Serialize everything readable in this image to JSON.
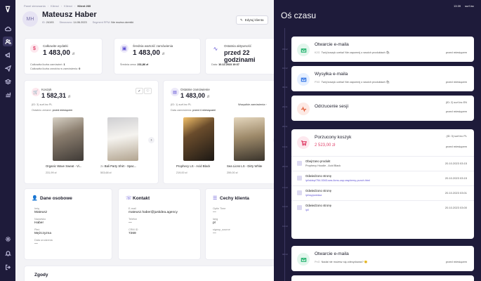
{
  "breadcrumbs": [
    "Panel sterowania",
    "Klienci",
    "Klienci",
    "Klient 260"
  ],
  "customer": {
    "initials": "MH",
    "name": "Mateusz Haber",
    "id_label": "ID:",
    "id": "24193",
    "created_label": "Stworzono:",
    "created": "14.06.2023",
    "segment_label": "Segment RFM:",
    "segment": "Nie można określić"
  },
  "edit_button": "Edytuj klienta",
  "stats": {
    "total_spend": {
      "label": "Całkowite wydatki",
      "value": "1 483,00",
      "currency": "zł",
      "orders_label": "Całkowita liczba zamówień:",
      "orders": "1",
      "returns_label": "Całkowita liczba zwrotów w zamówieniu:",
      "returns": "0"
    },
    "avg_order": {
      "label": "Średnia wartość zamówienia",
      "value": "1 483,00",
      "currency": "zł",
      "avg_price_label": "Średnia cena:",
      "avg_price": "231,86 zł"
    },
    "last_activity": {
      "label": "Ostatnia aktywność",
      "value": "przed 22 godzinami",
      "date_label": "Data:",
      "date": "10.12.2023 19:37"
    }
  },
  "cart": {
    "label": "Koszyk",
    "value": "1 582,31",
    "currency": "zł",
    "source": "(ID: 3) surf.inc PL",
    "updated_label": "Ostatnio zmiane:",
    "updated": "przed miesiącem",
    "products": [
      {
        "name": "Organic Wave Sweat - Vi...",
        "price": "231,99 zł",
        "qty": ""
      },
      {
        "name": "Bali Party Shirt - Spac...",
        "price": "503,68 zł",
        "qty": "2x"
      }
    ]
  },
  "last_order": {
    "label": "Ostatnie zamówienie",
    "value": "1 483,00",
    "currency": "zł",
    "source": "(ID: 1) surf.inc PL",
    "all_orders": "Wszystkie zamówienia",
    "date_label": "Data zamówienia:",
    "date": "przed 4 miesiącami",
    "products": [
      {
        "name": "Prophecy LS - Acid Black",
        "price": "219,00 zł"
      },
      {
        "name": "Sea Lions LS - Dirty White",
        "price": "259,00 zł"
      }
    ]
  },
  "personal": {
    "title": "Dane osobowe",
    "fields": [
      {
        "label": "Imię",
        "value": "Mateusz"
      },
      {
        "label": "Nazwisko",
        "value": "Haber"
      },
      {
        "label": "Płeć",
        "value": "Mężczyzna"
      },
      {
        "label": "Data urodzenia",
        "value": "—"
      }
    ]
  },
  "contact": {
    "title": "Kontakt",
    "fields": [
      {
        "label": "E-mail",
        "value": "mateusz.haber@justidea.agency"
      },
      {
        "label": "Telefon",
        "value": "—"
      },
      {
        "label": "CRM ID",
        "value": "7269"
      }
    ]
  },
  "traits": {
    "title": "Cechy klienta",
    "fields": [
      {
        "label": "Optin Time",
        "value": "—"
      },
      {
        "label": "lang",
        "value": "pl"
      },
      {
        "label": "signup_source",
        "value": "—"
      }
    ]
  },
  "consents": {
    "title": "Zgody"
  },
  "timeline": {
    "title": "Oś czasu",
    "clock": "13:39",
    "store": "surf.inc",
    "ticks": [
      "15.12",
      "10.12",
      "30.11",
      "22.11",
      "20.11",
      "13.11",
      "20.10",
      "17.10",
      "14.10",
      "13.10",
      "04.10"
    ],
    "events": [
      {
        "title": "Otwarcie e-maila",
        "tag": "K2G",
        "desc": "Twój koszyk czeka! Nie zapomnij o swoich produktach 🛍",
        "time": "przed miesiącem",
        "channel": ""
      },
      {
        "title": "Wysyłka e-maila",
        "tag": "P3G",
        "desc": "Twój koszyk czeka! Nie zapomnij o swoich produktach 🛍",
        "time": "przed miesiącem",
        "channel": ""
      },
      {
        "title": "Odrzucenie sesji",
        "tag": "",
        "desc": "",
        "time": "przed miesiącem",
        "channel": "(ID: 2) surf.inc EN"
      },
      {
        "title": "Porzucony koszyk",
        "tag": "",
        "desc": "2 523,00 zł",
        "time": "przed miesiącem",
        "channel": "(ID: 3) surf.inc PL"
      },
      {
        "title": "Otwarcie e-maila",
        "tag": "PnG",
        "desc": "Nadal nie możesz się zdecydować? 😊",
        "time": "przed miesiącem",
        "channel": ""
      }
    ],
    "sub_events": [
      {
        "title": "Obejrzano produkt",
        "detail": "Prophecy Hoodie - Acid Black",
        "time": "20.10.2023 03:15"
      },
      {
        "title": "Odwiedzono stronę",
        "detail": "/pl/sklep/754-5343-sea-lions-cap-raspberry-punch.html",
        "time": "20.10.2023 03:15"
      },
      {
        "title": "Odwiedzono stronę",
        "detail": "/pl/wyprzedaz",
        "time": "20.10.2023 03:01"
      },
      {
        "title": "Odwiedzono stronę",
        "detail": "/pl/",
        "time": "20.10.2023 03:00"
      }
    ]
  }
}
